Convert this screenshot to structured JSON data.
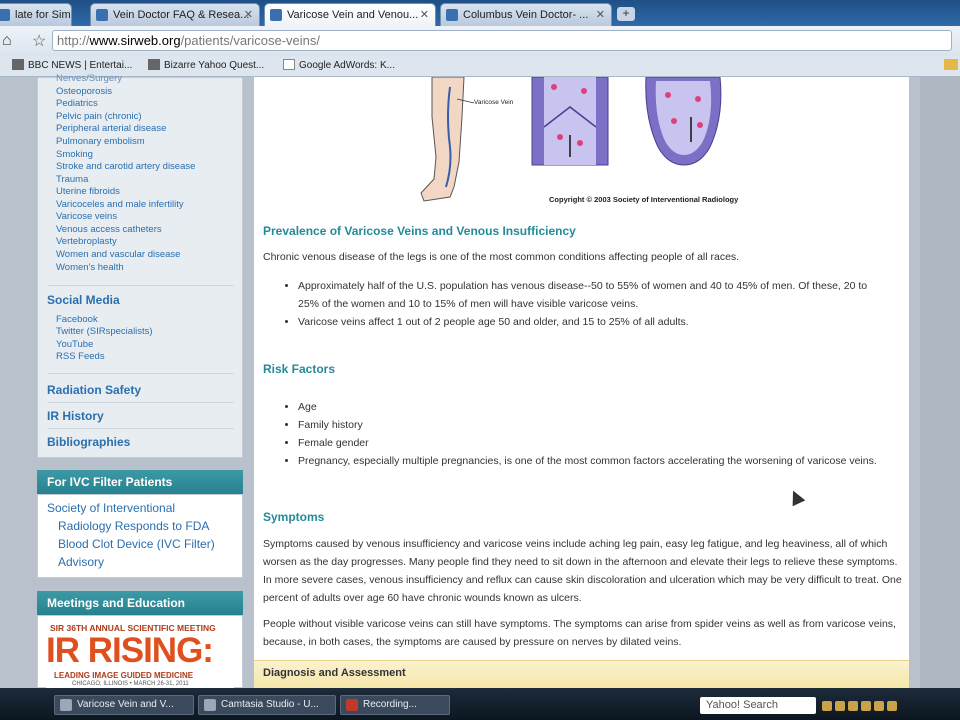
{
  "browser": {
    "tabs": [
      {
        "label": "late for Sim...",
        "active": false
      },
      {
        "label": "Vein Doctor FAQ & Resea...",
        "active": false
      },
      {
        "label": "Varicose Vein and Venou...",
        "active": true
      },
      {
        "label": "Columbus Vein Doctor- ...",
        "active": false
      }
    ],
    "new_tab": "+",
    "url_prefix": "http://",
    "url_host": "www.sirweb.org",
    "url_path": "/patients/varicose-veins/",
    "bookmarks": [
      {
        "label": "BBC NEWS | Entertai..."
      },
      {
        "label": "Bizarre Yahoo Quest..."
      },
      {
        "label": "Google AdWords: K..."
      }
    ]
  },
  "sidebar": {
    "partial_top": "Nerves/Surgery",
    "topics": [
      "Osteoporosis",
      "Pediatrics",
      "Pelvic pain (chronic)",
      "Peripheral arterial disease",
      "Pulmonary embolism",
      "Smoking",
      "Stroke and carotid artery disease",
      "Trauma",
      "Uterine fibroids",
      "Varicoceles and male infertility",
      "Varicose veins",
      "Venous access catheters",
      "Vertebroplasty",
      "Women and vascular disease",
      "Women's health"
    ],
    "social_heading": "Social Media",
    "social_links": [
      "Facebook",
      "Twitter (SIRspecialists)",
      "YouTube",
      "RSS Feeds"
    ],
    "radiation": "Radiation Safety",
    "history": "IR History",
    "bibliographies": "Bibliographies",
    "ivc_heading": "For IVC Filter Patients",
    "ivc_links": [
      "Society of Interventional",
      "Radiology Responds to FDA",
      "Blood Clot Device (IVC Filter)",
      "Advisory"
    ],
    "meetings_heading": "Meetings and Education",
    "banner": {
      "line1": "SIR 36TH ANNUAL SCIENTIFIC MEETING",
      "title": "IR RISING:",
      "tagline": "LEADING IMAGE GUIDED MEDICINE",
      "sub": "CHICAGO, ILLINOIS • MARCH 26-31, 2011"
    }
  },
  "main": {
    "illustration_label": "Varicose Vein",
    "copyright": "Copyright © 2003 Society of Interventional Radiology",
    "prevalence_heading": "Prevalence of Varicose Veins and Venous Insufficiency",
    "prevalence_intro": "Chronic venous disease of the legs is one of the most common conditions affecting people of all races.",
    "prevalence_bullets": [
      "Approximately half of the U.S. population has venous disease--50 to 55% of women and 40 to 45% of men. Of these, 20 to 25% of the women and 10 to 15% of men will have visible varicose veins.",
      "Varicose veins affect 1 out of 2 people age 50 and older, and 15 to 25% of all adults."
    ],
    "risk_heading": "Risk Factors",
    "risk_bullets": [
      "Age",
      "Family history",
      "Female gender",
      "Pregnancy, especially multiple pregnancies, is one of the most common factors accelerating the worsening of varicose veins."
    ],
    "symptoms_heading": "Symptoms",
    "symptoms_p1": "Symptoms caused by venous insufficiency and varicose veins include aching leg pain, easy leg fatigue, and leg heaviness, all of which worsen as the day progresses. Many people find they need to sit down in the afternoon and elevate their legs to relieve these symptoms. In more severe cases, venous insufficiency and reflux can cause skin discoloration and ulceration which may be very difficult to treat. One percent of adults over age 60 have chronic wounds known as ulcers.",
    "symptoms_p2": "People without visible varicose veins can still have symptoms. The symptoms can arise from spider veins as well as from varicose veins, because, in both cases, the symptoms are caused by pressure on nerves by dilated veins.",
    "diagnosis_heading": "Diagnosis and Assessment"
  },
  "taskbar": {
    "items": [
      "Varicose Vein and V...",
      "Camtasia Studio - U...",
      "Recording..."
    ],
    "search": "Yahoo! Search"
  }
}
